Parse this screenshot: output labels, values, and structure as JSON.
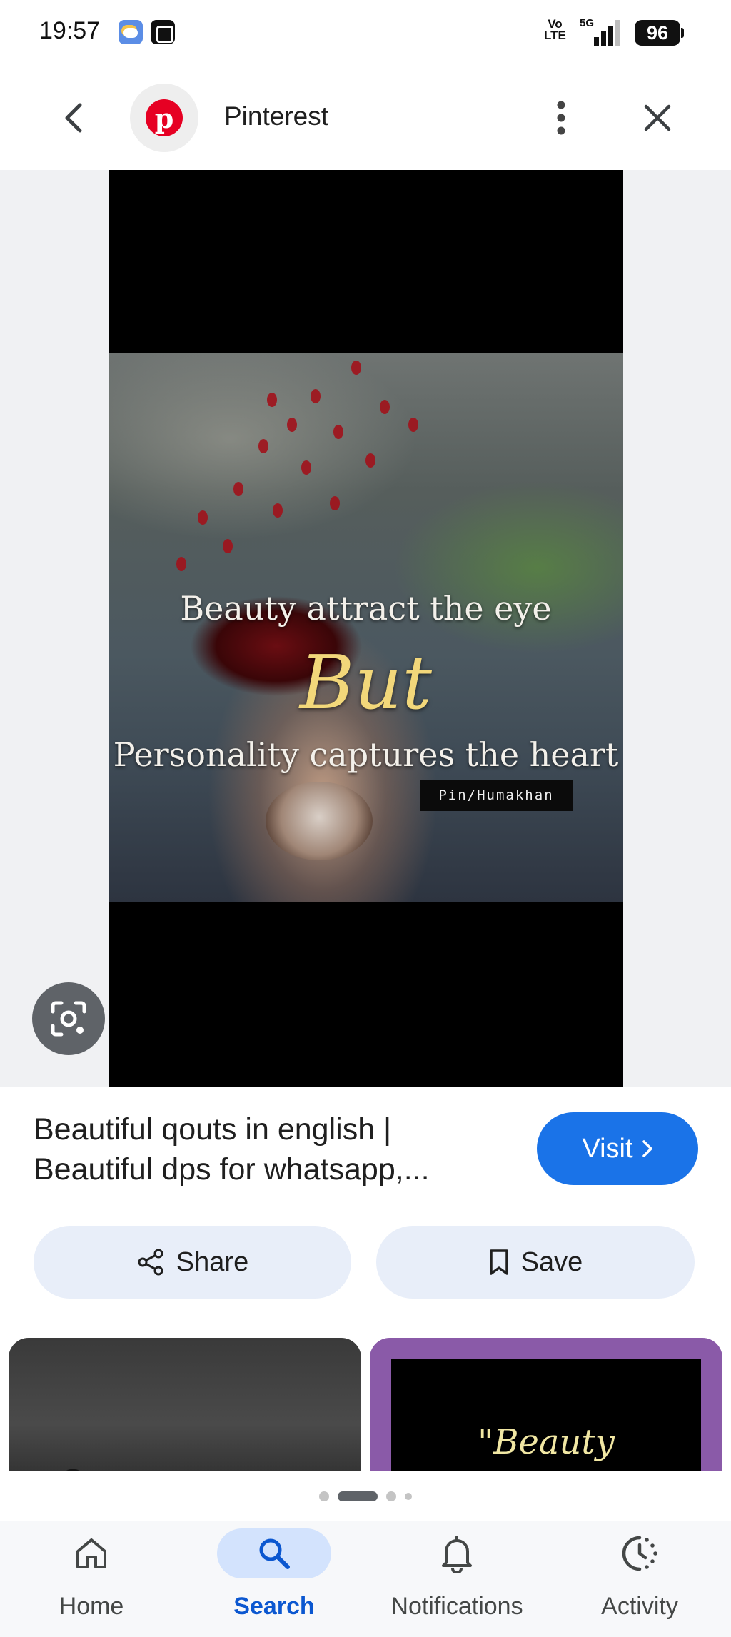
{
  "status_bar": {
    "time": "19:57",
    "network_type": "Vo\nLTE",
    "signal_tag": "5G",
    "battery": "96"
  },
  "app_bar": {
    "site_name": "Pinterest",
    "logo_letter": "p"
  },
  "pin_image": {
    "quote_line1": "Beauty attract the eye",
    "quote_but": "But",
    "quote_line2": "Personality captures the heart",
    "watermark": "Pin/Humakhan"
  },
  "result": {
    "title": "Beautiful qouts in english | Beautiful dps for whatsapp,...",
    "visit_label": "Visit",
    "share_label": "Share",
    "save_label": "Save"
  },
  "related": {
    "second_caption": "\"Beauty"
  },
  "pager": {
    "count": 4,
    "active_index": 1
  },
  "bottom_nav": {
    "items": [
      {
        "label": "Home",
        "icon": "home-icon"
      },
      {
        "label": "Search",
        "icon": "search-icon",
        "active": true
      },
      {
        "label": "Notifications",
        "icon": "bell-icon"
      },
      {
        "label": "Activity",
        "icon": "activity-icon"
      }
    ]
  },
  "colors": {
    "accent": "#1a73e8",
    "pinterest_red": "#e60023",
    "chip_bg": "#e8eef9",
    "nav_active_bg": "#d3e3fd"
  }
}
